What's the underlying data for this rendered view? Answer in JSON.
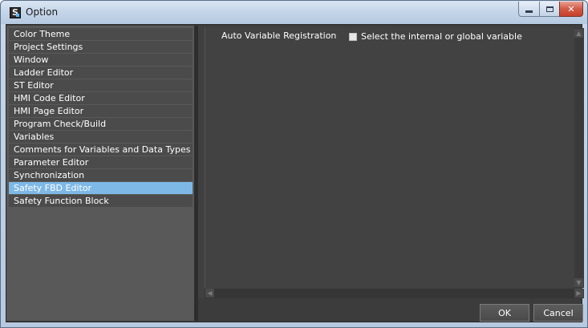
{
  "window": {
    "title": "Option",
    "app_icon_letter": "S"
  },
  "sidebar": {
    "items": [
      {
        "label": "Color Theme",
        "selected": false
      },
      {
        "label": "Project Settings",
        "selected": false
      },
      {
        "label": "Window",
        "selected": false
      },
      {
        "label": "Ladder Editor",
        "selected": false
      },
      {
        "label": "ST Editor",
        "selected": false
      },
      {
        "label": "HMI Code Editor",
        "selected": false
      },
      {
        "label": "HMI Page Editor",
        "selected": false
      },
      {
        "label": "Program Check/Build",
        "selected": false
      },
      {
        "label": "Variables",
        "selected": false
      },
      {
        "label": "Comments for Variables and Data Types",
        "selected": false
      },
      {
        "label": "Parameter Editor",
        "selected": false
      },
      {
        "label": "Synchronization",
        "selected": false
      },
      {
        "label": "Safety FBD Editor",
        "selected": true
      },
      {
        "label": "Safety Function Block",
        "selected": false
      }
    ]
  },
  "settings": {
    "auto_variable_label": "Auto Variable Registration",
    "checkbox_label": "Select the internal or global variable",
    "checkbox_checked": false
  },
  "buttons": {
    "ok": "OK",
    "cancel": "Cancel"
  },
  "colors": {
    "selection": "#7eb8e6",
    "background": "#3c3c3c"
  }
}
